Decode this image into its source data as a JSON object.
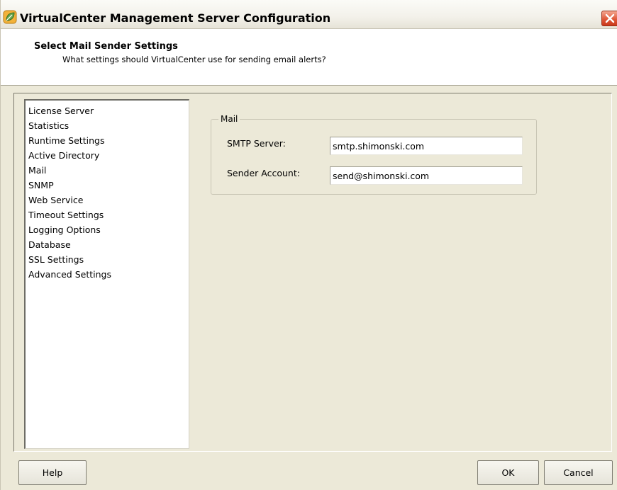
{
  "window": {
    "title": "VirtualCenter Management Server Configuration",
    "icons": {
      "app": "vmware-leaf-icon",
      "close": "close-icon"
    }
  },
  "header": {
    "title": "Select Mail Sender Settings",
    "subtitle": "What settings should VirtualCenter use for sending email alerts?"
  },
  "nav": {
    "items": [
      {
        "label": "License Server"
      },
      {
        "label": "Statistics"
      },
      {
        "label": "Runtime Settings"
      },
      {
        "label": "Active Directory"
      },
      {
        "label": "Mail"
      },
      {
        "label": "SNMP"
      },
      {
        "label": "Web Service"
      },
      {
        "label": "Timeout Settings"
      },
      {
        "label": "Logging Options"
      },
      {
        "label": "Database"
      },
      {
        "label": "SSL Settings"
      },
      {
        "label": "Advanced Settings"
      }
    ]
  },
  "mail": {
    "group_label": "Mail",
    "smtp_label": "SMTP Server:",
    "smtp_value": "smtp.shimonski.com",
    "sender_label": "Sender Account:",
    "sender_value": "send@shimonski.com"
  },
  "buttons": {
    "help": "Help",
    "ok": "OK",
    "cancel": "Cancel"
  },
  "colors": {
    "dialog_bg": "#ece9d8",
    "close_red": "#e0593a",
    "icon_green": "#6aa84f"
  }
}
